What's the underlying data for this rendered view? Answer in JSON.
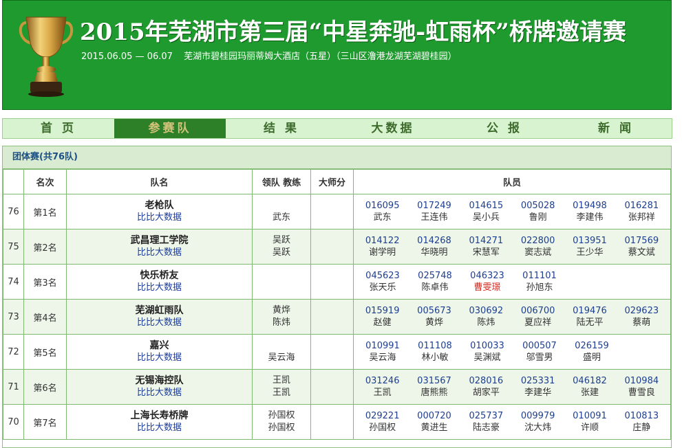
{
  "header": {
    "title": "2015年芜湖市第三届“中星奔驰-虹雨杯”桥牌邀请赛",
    "dates": "2015.06.05 — 06.07",
    "venue": "芜湖市碧桂园玛丽蒂姆大酒店（五星）（三山区澛港龙湖芜湖碧桂园）"
  },
  "nav": {
    "items": [
      "首 页",
      "参赛队",
      "结 果",
      "大数据",
      "公 报",
      "新 闻"
    ],
    "active_index": 1
  },
  "panel": {
    "title": "团体赛(共76队)"
  },
  "table": {
    "headers": {
      "blank": "",
      "rank": "名次",
      "team": "队名",
      "lead": "领队 教练",
      "master": "大师分",
      "members": "队员"
    },
    "rows": [
      {
        "num": "76",
        "rank": "第1名",
        "team": "老枪队",
        "link": "比比大数据",
        "lead": [
          "武东"
        ],
        "master": "",
        "members": [
          {
            "id": "016095",
            "name": "武东"
          },
          {
            "id": "017249",
            "name": "王连伟"
          },
          {
            "id": "014615",
            "name": "吴小兵"
          },
          {
            "id": "005028",
            "name": "鲁刚"
          },
          {
            "id": "019498",
            "name": "李建伟"
          },
          {
            "id": "016281",
            "name": "张邦祥"
          }
        ]
      },
      {
        "num": "75",
        "rank": "第2名",
        "team": "武昌理工学院",
        "link": "比比大数据",
        "lead": [
          "吴跃",
          "吴跃"
        ],
        "master": "",
        "members": [
          {
            "id": "014122",
            "name": "谢学明"
          },
          {
            "id": "014268",
            "name": "华晓明"
          },
          {
            "id": "014271",
            "name": "宋慧军"
          },
          {
            "id": "022800",
            "name": "窦志斌"
          },
          {
            "id": "013951",
            "name": "王少华"
          },
          {
            "id": "017569",
            "name": "蔡文斌"
          }
        ]
      },
      {
        "num": "74",
        "rank": "第3名",
        "team": "快乐桥友",
        "link": "比比大数据",
        "lead": [],
        "master": "",
        "members": [
          {
            "id": "045623",
            "name": "张天乐"
          },
          {
            "id": "025748",
            "name": "陈卓伟"
          },
          {
            "id": "046323",
            "name": "曹雯璟",
            "highlight": true
          },
          {
            "id": "011101",
            "name": "孙旭东"
          }
        ]
      },
      {
        "num": "73",
        "rank": "第4名",
        "team": "芜湖虹雨队",
        "link": "比比大数据",
        "lead": [
          "黄烨",
          "陈炜"
        ],
        "master": "",
        "members": [
          {
            "id": "015919",
            "name": "赵健"
          },
          {
            "id": "005673",
            "name": "黄烨"
          },
          {
            "id": "030692",
            "name": "陈炜"
          },
          {
            "id": "006700",
            "name": "夏应祥"
          },
          {
            "id": "019476",
            "name": "陆无平"
          },
          {
            "id": "029623",
            "name": "蔡萌"
          }
        ]
      },
      {
        "num": "72",
        "rank": "第5名",
        "team": "嘉兴",
        "link": "比比大数据",
        "lead": [
          "吴云海"
        ],
        "master": "",
        "members": [
          {
            "id": "010991",
            "name": "吴云海"
          },
          {
            "id": "011108",
            "name": "林小敏"
          },
          {
            "id": "010033",
            "name": "吴渊斌"
          },
          {
            "id": "000507",
            "name": "邬雪男"
          },
          {
            "id": "026159",
            "name": "盛明"
          }
        ]
      },
      {
        "num": "71",
        "rank": "第6名",
        "team": "无锡海控队",
        "link": "比比大数据",
        "lead": [
          "王凯",
          "王凯"
        ],
        "master": "",
        "members": [
          {
            "id": "031246",
            "name": "王凯"
          },
          {
            "id": "031567",
            "name": "唐熊熊"
          },
          {
            "id": "028016",
            "name": "胡家平"
          },
          {
            "id": "025331",
            "name": "李建华"
          },
          {
            "id": "046182",
            "name": "张建"
          },
          {
            "id": "010984",
            "name": "曹雪良"
          }
        ]
      },
      {
        "num": "70",
        "rank": "第7名",
        "team": "上海长寿桥牌",
        "link": "比比大数据",
        "lead": [
          "孙国权",
          "孙国权"
        ],
        "master": "",
        "members": [
          {
            "id": "029221",
            "name": "孙国权"
          },
          {
            "id": "000720",
            "name": "黄进生"
          },
          {
            "id": "025737",
            "name": "陆志豪"
          },
          {
            "id": "009979",
            "name": "沈大炜"
          },
          {
            "id": "010091",
            "name": "许顺"
          },
          {
            "id": "010813",
            "name": "庄静"
          }
        ]
      }
    ]
  },
  "colors": {
    "banner_green": "#1f9a2e",
    "nav_active": "#2d7f28",
    "link_blue": "#1a3a9c",
    "highlight_red": "#d1251a"
  }
}
